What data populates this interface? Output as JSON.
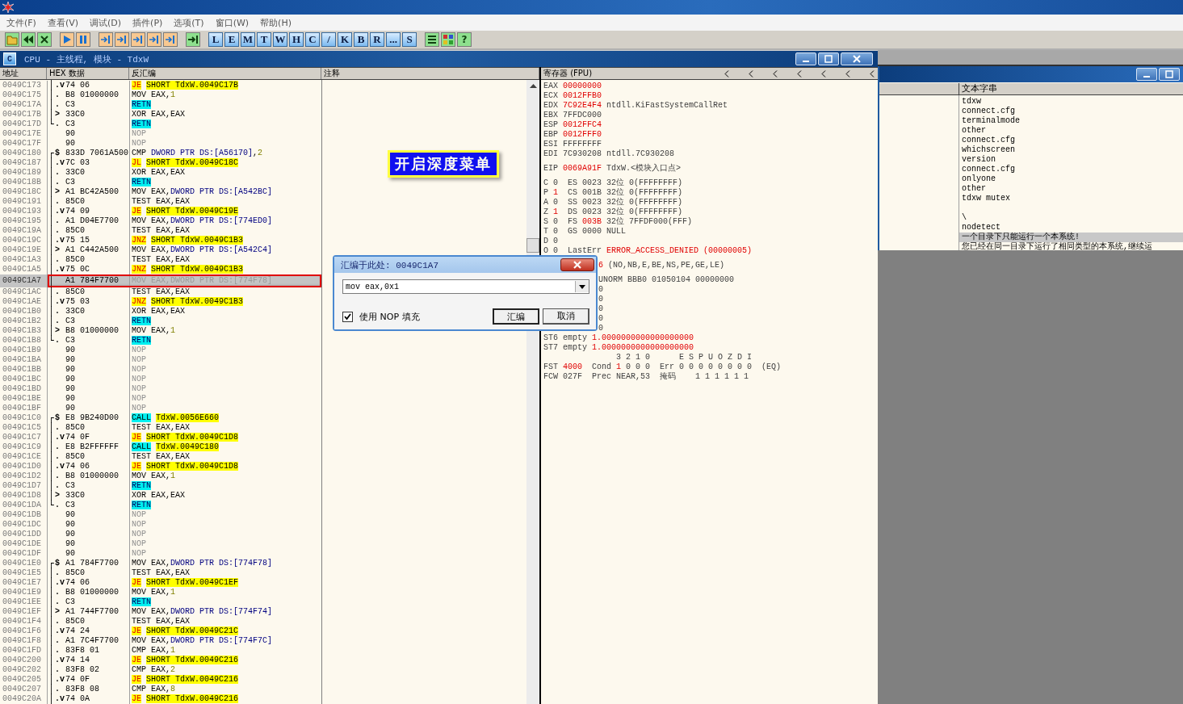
{
  "menu": [
    "文件(F)",
    "查看(V)",
    "调试(D)",
    "插件(P)",
    "选项(T)",
    "窗口(W)",
    "帮助(H)"
  ],
  "toolbar": {
    "letters": [
      "L",
      "E",
      "M",
      "T",
      "W",
      "H",
      "C",
      "/",
      "K",
      "B",
      "R",
      "...",
      "S"
    ],
    "help": "?"
  },
  "cpu_window": {
    "icon": "C",
    "title": "CPU - 主线程, 模块 - TdxW",
    "columns": [
      "地址",
      "HEX 数据",
      "反汇编",
      "注释"
    ],
    "rows": [
      {
        "addr": "0049C173",
        "bracket": "│",
        "flow": ".v",
        "hex": "74 06",
        "selected": false,
        "asm": [
          {
            "kind": "jump",
            "text": "JE"
          },
          {
            "kind": "target",
            "text": "SHORT TdxW.0049C17B"
          }
        ]
      },
      {
        "addr": "0049C175",
        "bracket": "│",
        "flow": ".",
        "hex": "B8 01000000",
        "selected": false,
        "asm": [
          {
            "kind": "text",
            "text": "MOV EAX,"
          },
          {
            "kind": "num",
            "text": "1"
          }
        ]
      },
      {
        "addr": "0049C17A",
        "bracket": "│",
        "flow": ".",
        "hex": "C3",
        "selected": false,
        "asm": [
          {
            "kind": "ret",
            "text": "RETN"
          }
        ]
      },
      {
        "addr": "0049C17B",
        "bracket": "│",
        "flow": ">",
        "hex": "33C0",
        "selected": false,
        "asm": [
          {
            "kind": "text",
            "text": "XOR EAX,EAX"
          }
        ]
      },
      {
        "addr": "0049C17D",
        "bracket": "└",
        "flow": ".",
        "hex": "C3",
        "selected": false,
        "asm": [
          {
            "kind": "ret",
            "text": "RETN"
          }
        ]
      },
      {
        "addr": "0049C17E",
        "hex": "90",
        "selected": false,
        "asm": [
          {
            "kind": "nop",
            "text": "NOP"
          }
        ]
      },
      {
        "addr": "0049C17F",
        "hex": "90",
        "selected": false,
        "asm": [
          {
            "kind": "nop",
            "text": "NOP"
          }
        ]
      },
      {
        "addr": "0049C180",
        "bracket": "┌",
        "flow": "$",
        "hex": "833D 7061A500",
        "selected": false,
        "asm": [
          {
            "kind": "text",
            "text": "CMP "
          },
          {
            "kind": "mem",
            "text": "DWORD PTR DS:[A56170]"
          },
          {
            "kind": "text",
            "text": ","
          },
          {
            "kind": "num",
            "text": "2"
          }
        ]
      },
      {
        "addr": "0049C187",
        "bracket": "│",
        "flow": ".v",
        "hex": "7C 03",
        "selected": false,
        "asm": [
          {
            "kind": "jump",
            "text": "JL"
          },
          {
            "kind": "target",
            "text": "SHORT TdxW.0049C18C"
          }
        ]
      },
      {
        "addr": "0049C189",
        "bracket": "│",
        "flow": ".",
        "hex": "33C0",
        "selected": false,
        "asm": [
          {
            "kind": "text",
            "text": "XOR EAX,EAX"
          }
        ]
      },
      {
        "addr": "0049C18B",
        "bracket": "│",
        "flow": ".",
        "hex": "C3",
        "selected": false,
        "asm": [
          {
            "kind": "ret",
            "text": "RETN"
          }
        ]
      },
      {
        "addr": "0049C18C",
        "bracket": "│",
        "flow": ">",
        "hex": "A1 BC42A500",
        "selected": false,
        "asm": [
          {
            "kind": "text",
            "text": "MOV EAX,"
          },
          {
            "kind": "mem",
            "text": "DWORD PTR DS:[A542BC]"
          }
        ]
      },
      {
        "addr": "0049C191",
        "bracket": "│",
        "flow": ".",
        "hex": "85C0",
        "selected": false,
        "asm": [
          {
            "kind": "text",
            "text": "TEST EAX,EAX"
          }
        ]
      },
      {
        "addr": "0049C193",
        "bracket": "│",
        "flow": ".v",
        "hex": "74 09",
        "selected": false,
        "asm": [
          {
            "kind": "jump",
            "text": "JE"
          },
          {
            "kind": "target",
            "text": "SHORT TdxW.0049C19E"
          }
        ]
      },
      {
        "addr": "0049C195",
        "bracket": "│",
        "flow": ".",
        "hex": "A1 D04E7700",
        "selected": false,
        "asm": [
          {
            "kind": "text",
            "text": "MOV EAX,"
          },
          {
            "kind": "mem",
            "text": "DWORD PTR DS:[774ED0]"
          }
        ]
      },
      {
        "addr": "0049C19A",
        "bracket": "│",
        "flow": ".",
        "hex": "85C0",
        "selected": false,
        "asm": [
          {
            "kind": "text",
            "text": "TEST EAX,EAX"
          }
        ]
      },
      {
        "addr": "0049C19C",
        "bracket": "│",
        "flow": ".v",
        "hex": "75 15",
        "selected": false,
        "asm": [
          {
            "kind": "jump",
            "text": "JNZ"
          },
          {
            "kind": "target",
            "text": "SHORT TdxW.0049C1B3"
          }
        ]
      },
      {
        "addr": "0049C19E",
        "bracket": "│",
        "flow": ">",
        "hex": "A1 C442A500",
        "selected": false,
        "asm": [
          {
            "kind": "text",
            "text": "MOV EAX,"
          },
          {
            "kind": "mem",
            "text": "DWORD PTR DS:[A542C4]"
          }
        ]
      },
      {
        "addr": "0049C1A3",
        "bracket": "│",
        "flow": ".",
        "hex": "85C0",
        "selected": false,
        "asm": [
          {
            "kind": "text",
            "text": "TEST EAX,EAX"
          }
        ]
      },
      {
        "addr": "0049C1A5",
        "bracket": "│",
        "flow": ".v",
        "hex": "75 0C",
        "selected": false,
        "asm": [
          {
            "kind": "jump",
            "text": "JNZ"
          },
          {
            "kind": "target",
            "text": "SHORT TdxW.0049C1B3"
          }
        ]
      },
      {
        "addr": "0049C1A7",
        "bracket": "│",
        "hex": "A1 784F7700",
        "selected": true,
        "asm": [
          {
            "kind": "text",
            "text": "MOV EAX,"
          },
          {
            "kind": "mem",
            "text": "DWORD PTR DS:[774F78]"
          }
        ]
      },
      {
        "addr": "0049C1AC",
        "bracket": "│",
        "flow": ".",
        "hex": "85C0",
        "selected": false,
        "asm": [
          {
            "kind": "text",
            "text": "TEST EAX,EAX"
          }
        ]
      },
      {
        "addr": "0049C1AE",
        "bracket": "│",
        "flow": ".v",
        "hex": "75 03",
        "selected": false,
        "asm": [
          {
            "kind": "jump",
            "text": "JNZ"
          },
          {
            "kind": "target",
            "text": "SHORT TdxW.0049C1B3"
          }
        ]
      },
      {
        "addr": "0049C1B0",
        "bracket": "│",
        "flow": ".",
        "hex": "33C0",
        "selected": false,
        "asm": [
          {
            "kind": "text",
            "text": "XOR EAX,EAX"
          }
        ]
      },
      {
        "addr": "0049C1B2",
        "bracket": "│",
        "flow": ".",
        "hex": "C3",
        "selected": false,
        "asm": [
          {
            "kind": "ret",
            "text": "RETN"
          }
        ]
      },
      {
        "addr": "0049C1B3",
        "bracket": "│",
        "flow": ">",
        "hex": "B8 01000000",
        "selected": false,
        "asm": [
          {
            "kind": "text",
            "text": "MOV EAX,"
          },
          {
            "kind": "num",
            "text": "1"
          }
        ]
      },
      {
        "addr": "0049C1B8",
        "bracket": "└",
        "flow": ".",
        "hex": "C3",
        "selected": false,
        "asm": [
          {
            "kind": "ret",
            "text": "RETN"
          }
        ]
      },
      {
        "addr": "0049C1B9",
        "hex": "90",
        "selected": false,
        "asm": [
          {
            "kind": "nop",
            "text": "NOP"
          }
        ]
      },
      {
        "addr": "0049C1BA",
        "hex": "90",
        "selected": false,
        "asm": [
          {
            "kind": "nop",
            "text": "NOP"
          }
        ]
      },
      {
        "addr": "0049C1BB",
        "hex": "90",
        "selected": false,
        "asm": [
          {
            "kind": "nop",
            "text": "NOP"
          }
        ]
      },
      {
        "addr": "0049C1BC",
        "hex": "90",
        "selected": false,
        "asm": [
          {
            "kind": "nop",
            "text": "NOP"
          }
        ]
      },
      {
        "addr": "0049C1BD",
        "hex": "90",
        "selected": false,
        "asm": [
          {
            "kind": "nop",
            "text": "NOP"
          }
        ]
      },
      {
        "addr": "0049C1BE",
        "hex": "90",
        "selected": false,
        "asm": [
          {
            "kind": "nop",
            "text": "NOP"
          }
        ]
      },
      {
        "addr": "0049C1BF",
        "hex": "90",
        "selected": false,
        "asm": [
          {
            "kind": "nop",
            "text": "NOP"
          }
        ]
      },
      {
        "addr": "0049C1C0",
        "bracket": "┌",
        "flow": "$",
        "hex": "E8 9B240D00",
        "selected": false,
        "asm": [
          {
            "kind": "call",
            "text": "CALL"
          },
          {
            "kind": "target",
            "text": "TdxW.0056E660"
          }
        ]
      },
      {
        "addr": "0049C1C5",
        "bracket": "│",
        "flow": ".",
        "hex": "85C0",
        "selected": false,
        "asm": [
          {
            "kind": "text",
            "text": "TEST EAX,EAX"
          }
        ]
      },
      {
        "addr": "0049C1C7",
        "bracket": "│",
        "flow": ".v",
        "hex": "74 0F",
        "selected": false,
        "asm": [
          {
            "kind": "jump",
            "text": "JE"
          },
          {
            "kind": "target",
            "text": "SHORT TdxW.0049C1D8"
          }
        ]
      },
      {
        "addr": "0049C1C9",
        "bracket": "│",
        "flow": ".",
        "hex": "E8 B2FFFFFF",
        "selected": false,
        "asm": [
          {
            "kind": "call",
            "text": "CALL"
          },
          {
            "kind": "target",
            "text": "TdxW.0049C180"
          }
        ]
      },
      {
        "addr": "0049C1CE",
        "bracket": "│",
        "flow": ".",
        "hex": "85C0",
        "selected": false,
        "asm": [
          {
            "kind": "text",
            "text": "TEST EAX,EAX"
          }
        ]
      },
      {
        "addr": "0049C1D0",
        "bracket": "│",
        "flow": ".v",
        "hex": "74 06",
        "selected": false,
        "asm": [
          {
            "kind": "jump",
            "text": "JE"
          },
          {
            "kind": "target",
            "text": "SHORT TdxW.0049C1D8"
          }
        ]
      },
      {
        "addr": "0049C1D2",
        "bracket": "│",
        "flow": ".",
        "hex": "B8 01000000",
        "selected": false,
        "asm": [
          {
            "kind": "text",
            "text": "MOV EAX,"
          },
          {
            "kind": "num",
            "text": "1"
          }
        ]
      },
      {
        "addr": "0049C1D7",
        "bracket": "│",
        "flow": ".",
        "hex": "C3",
        "selected": false,
        "asm": [
          {
            "kind": "ret",
            "text": "RETN"
          }
        ]
      },
      {
        "addr": "0049C1D8",
        "bracket": "│",
        "flow": ">",
        "hex": "33C0",
        "selected": false,
        "asm": [
          {
            "kind": "text",
            "text": "XOR EAX,EAX"
          }
        ]
      },
      {
        "addr": "0049C1DA",
        "bracket": "└",
        "flow": ".",
        "hex": "C3",
        "selected": false,
        "asm": [
          {
            "kind": "ret",
            "text": "RETN"
          }
        ]
      },
      {
        "addr": "0049C1DB",
        "hex": "90",
        "selected": false,
        "asm": [
          {
            "kind": "nop",
            "text": "NOP"
          }
        ]
      },
      {
        "addr": "0049C1DC",
        "hex": "90",
        "selected": false,
        "asm": [
          {
            "kind": "nop",
            "text": "NOP"
          }
        ]
      },
      {
        "addr": "0049C1DD",
        "hex": "90",
        "selected": false,
        "asm": [
          {
            "kind": "nop",
            "text": "NOP"
          }
        ]
      },
      {
        "addr": "0049C1DE",
        "hex": "90",
        "selected": false,
        "asm": [
          {
            "kind": "nop",
            "text": "NOP"
          }
        ]
      },
      {
        "addr": "0049C1DF",
        "hex": "90",
        "selected": false,
        "asm": [
          {
            "kind": "nop",
            "text": "NOP"
          }
        ]
      },
      {
        "addr": "0049C1E0",
        "bracket": "┌",
        "flow": "$",
        "hex": "A1 784F7700",
        "selected": false,
        "asm": [
          {
            "kind": "text",
            "text": "MOV EAX,"
          },
          {
            "kind": "mem",
            "text": "DWORD PTR DS:[774F78]"
          }
        ]
      },
      {
        "addr": "0049C1E5",
        "bracket": "│",
        "flow": ".",
        "hex": "85C0",
        "selected": false,
        "asm": [
          {
            "kind": "text",
            "text": "TEST EAX,EAX"
          }
        ]
      },
      {
        "addr": "0049C1E7",
        "bracket": "│",
        "flow": ".v",
        "hex": "74 06",
        "selected": false,
        "asm": [
          {
            "kind": "jump",
            "text": "JE"
          },
          {
            "kind": "target",
            "text": "SHORT TdxW.0049C1EF"
          }
        ]
      },
      {
        "addr": "0049C1E9",
        "bracket": "│",
        "flow": ".",
        "hex": "B8 01000000",
        "selected": false,
        "asm": [
          {
            "kind": "text",
            "text": "MOV EAX,"
          },
          {
            "kind": "num",
            "text": "1"
          }
        ]
      },
      {
        "addr": "0049C1EE",
        "bracket": "│",
        "flow": ".",
        "hex": "C3",
        "selected": false,
        "asm": [
          {
            "kind": "ret",
            "text": "RETN"
          }
        ]
      },
      {
        "addr": "0049C1EF",
        "bracket": "│",
        "flow": ">",
        "hex": "A1 744F7700",
        "selected": false,
        "asm": [
          {
            "kind": "text",
            "text": "MOV EAX,"
          },
          {
            "kind": "mem",
            "text": "DWORD PTR DS:[774F74]"
          }
        ]
      },
      {
        "addr": "0049C1F4",
        "bracket": "│",
        "flow": ".",
        "hex": "85C0",
        "selected": false,
        "asm": [
          {
            "kind": "text",
            "text": "TEST EAX,EAX"
          }
        ]
      },
      {
        "addr": "0049C1F6",
        "bracket": "│",
        "flow": ".v",
        "hex": "74 24",
        "selected": false,
        "asm": [
          {
            "kind": "jump",
            "text": "JE"
          },
          {
            "kind": "target",
            "text": "SHORT TdxW.0049C21C"
          }
        ]
      },
      {
        "addr": "0049C1F8",
        "bracket": "│",
        "flow": ".",
        "hex": "A1 7C4F7700",
        "selected": false,
        "asm": [
          {
            "kind": "text",
            "text": "MOV EAX,"
          },
          {
            "kind": "mem",
            "text": "DWORD PTR DS:[774F7C]"
          }
        ]
      },
      {
        "addr": "0049C1FD",
        "bracket": "│",
        "flow": ".",
        "hex": "83F8 01",
        "selected": false,
        "asm": [
          {
            "kind": "text",
            "text": "CMP EAX,"
          },
          {
            "kind": "num",
            "text": "1"
          }
        ]
      },
      {
        "addr": "0049C200",
        "bracket": "│",
        "flow": ".v",
        "hex": "74 14",
        "selected": false,
        "asm": [
          {
            "kind": "jump",
            "text": "JE"
          },
          {
            "kind": "target",
            "text": "SHORT TdxW.0049C216"
          }
        ]
      },
      {
        "addr": "0049C202",
        "bracket": "│",
        "flow": ".",
        "hex": "83F8 02",
        "selected": false,
        "asm": [
          {
            "kind": "text",
            "text": "CMP EAX,"
          },
          {
            "kind": "num",
            "text": "2"
          }
        ]
      },
      {
        "addr": "0049C205",
        "bracket": "│",
        "flow": ".v",
        "hex": "74 0F",
        "selected": false,
        "asm": [
          {
            "kind": "jump",
            "text": "JE"
          },
          {
            "kind": "target",
            "text": "SHORT TdxW.0049C216"
          }
        ]
      },
      {
        "addr": "0049C207",
        "bracket": "│",
        "flow": ".",
        "hex": "83F8 08",
        "selected": false,
        "asm": [
          {
            "kind": "text",
            "text": "CMP EAX,"
          },
          {
            "kind": "num",
            "text": "8"
          }
        ]
      },
      {
        "addr": "0049C20A",
        "bracket": "│",
        "flow": ".v",
        "hex": "74 0A",
        "selected": false,
        "asm": [
          {
            "kind": "jump",
            "text": "JE"
          },
          {
            "kind": "target",
            "text": "SHORT TdxW.0049C216"
          }
        ]
      }
    ],
    "registers": {
      "title": "寄存器 (FPU)",
      "groups": [
        [
          {
            "kind": "full",
            "parts": [
              {
                "text": "EAX "
              },
              {
                "text": "00000000",
                "changed": true
              }
            ]
          },
          {
            "kind": "full",
            "parts": [
              {
                "text": "ECX "
              },
              {
                "text": "0012FFB0",
                "changed": true
              }
            ]
          },
          {
            "kind": "full",
            "parts": [
              {
                "text": "EDX "
              },
              {
                "text": "7C92E4F4",
                "changed": true
              },
              {
                "text": " ntdll.KiFastSystemCallRet"
              }
            ]
          },
          {
            "kind": "full",
            "parts": [
              {
                "text": "EBX 7FFDC000"
              }
            ]
          },
          {
            "kind": "full",
            "parts": [
              {
                "text": "ESP "
              },
              {
                "text": "0012FFC4",
                "changed": true
              }
            ]
          },
          {
            "kind": "full",
            "parts": [
              {
                "text": "EBP "
              },
              {
                "text": "0012FFF0",
                "changed": true
              }
            ]
          },
          {
            "kind": "full",
            "parts": [
              {
                "text": "ESI FFFFFFFF"
              }
            ]
          },
          {
            "kind": "full",
            "parts": [
              {
                "text": "EDI 7C930208 ntdll.7C930208"
              }
            ]
          }
        ],
        [
          {
            "kind": "full",
            "parts": [
              {
                "text": "EIP "
              },
              {
                "text": "0069A91F",
                "changed": true
              },
              {
                "text": " TdxW.<模块入口点>"
              }
            ]
          }
        ],
        [
          {
            "kind": "full",
            "parts": [
              {
                "text": "C 0  ES 0023 32位 0(FFFFFFFF)"
              }
            ]
          },
          {
            "kind": "full",
            "parts": [
              {
                "text": "P "
              },
              {
                "text": "1",
                "changed": true
              },
              {
                "text": "  CS 001B 32位 0(FFFFFFFF)"
              }
            ]
          },
          {
            "kind": "full",
            "parts": [
              {
                "text": "A 0  SS 0023 32位 0(FFFFFFFF)"
              }
            ]
          },
          {
            "kind": "full",
            "parts": [
              {
                "text": "Z "
              },
              {
                "text": "1",
                "changed": true
              },
              {
                "text": "  DS 0023 32位 0(FFFFFFFF)"
              }
            ]
          },
          {
            "kind": "full",
            "parts": [
              {
                "text": "S 0  FS "
              },
              {
                "text": "003B",
                "changed": true
              },
              {
                "text": " 32位 7FFDF000(FFF)"
              }
            ]
          },
          {
            "kind": "full",
            "parts": [
              {
                "text": "T 0  GS 0000 NULL"
              }
            ]
          },
          {
            "kind": "full",
            "parts": [
              {
                "text": "D 0"
              }
            ]
          },
          {
            "kind": "full",
            "parts": [
              {
                "text": "O 0  LastErr "
              },
              {
                "text": "ERROR_ACCESS_DENIED (00000005)",
                "changed": true
              }
            ]
          }
        ],
        [
          {
            "kind": "partial",
            "parts": [
              {
                "text": "6",
                "changed": true
              },
              {
                "text": " (NO,NB,E,BE,NS,PE,GE,LE)"
              }
            ]
          }
        ],
        [
          {
            "kind": "partial",
            "parts": [
              {
                "text": "UNORM BBB0 01050104 00000000"
              }
            ]
          },
          {
            "kind": "partial",
            "parts": [
              {
                "text": "0"
              }
            ]
          },
          {
            "kind": "partial",
            "parts": [
              {
                "text": "0"
              }
            ]
          },
          {
            "kind": "partial",
            "parts": [
              {
                "text": "0"
              }
            ]
          },
          {
            "kind": "partial",
            "parts": [
              {
                "text": "0"
              }
            ]
          },
          {
            "kind": "partial",
            "parts": [
              {
                "text": "0"
              }
            ]
          },
          {
            "kind": "full",
            "parts": [
              {
                "text": "ST6 empty "
              },
              {
                "text": "1.0000000000000000000",
                "changed": true
              }
            ]
          },
          {
            "kind": "full",
            "parts": [
              {
                "text": "ST7 empty "
              },
              {
                "text": "1.0000000000000000000",
                "changed": true
              }
            ]
          },
          {
            "kind": "full",
            "parts": [
              {
                "text": "               3 2 1 0      E S P U O Z D I"
              }
            ]
          },
          {
            "kind": "full",
            "parts": [
              {
                "text": "FST "
              },
              {
                "text": "4000",
                "changed": true
              },
              {
                "text": "  Cond "
              },
              {
                "text": "1",
                "changed": true
              },
              {
                "text": " 0 0 0  Err 0 0 0 0 0 0 0 0  (EQ)"
              }
            ]
          },
          {
            "kind": "full",
            "parts": [
              {
                "text": "FCW 027F  Prec NEAR,53  掩码    1 1 1 1 1 1"
              }
            ]
          }
        ]
      ]
    }
  },
  "strings_window": {
    "column": "文本字串",
    "groups": [
      [
        {
          "text": "tdxw",
          "selected": false
        },
        {
          "text": "connect.cfg",
          "selected": false
        },
        {
          "text": "terminalmode",
          "selected": false
        },
        {
          "text": "other",
          "selected": false
        },
        {
          "text": "connect.cfg",
          "selected": false
        },
        {
          "text": "whichscreen",
          "selected": false
        },
        {
          "text": "version",
          "selected": false
        },
        {
          "text": "connect.cfg",
          "selected": false
        },
        {
          "text": "onlyone",
          "selected": false
        },
        {
          "text": "other",
          "selected": false
        },
        {
          "text": "tdxw mutex",
          "selected": false
        }
      ],
      [
        {
          "text": "\\",
          "selected": false
        },
        {
          "text": "nodetect",
          "selected": false
        },
        {
          "text": "一个目录下只能运行一个本系统!",
          "selected": true
        },
        {
          "text": "您已经在同一目录下运行了相同类型的本系统,继续运",
          "selected": false
        }
      ]
    ]
  },
  "annotation": "开启深度菜单",
  "dialog": {
    "title": "汇编于此处: 0049C1A7",
    "value": "mov eax,0x1",
    "checkbox": {
      "label": "使用 NOP 填充",
      "checked": true
    },
    "buttons": [
      "汇编",
      "取消"
    ]
  }
}
